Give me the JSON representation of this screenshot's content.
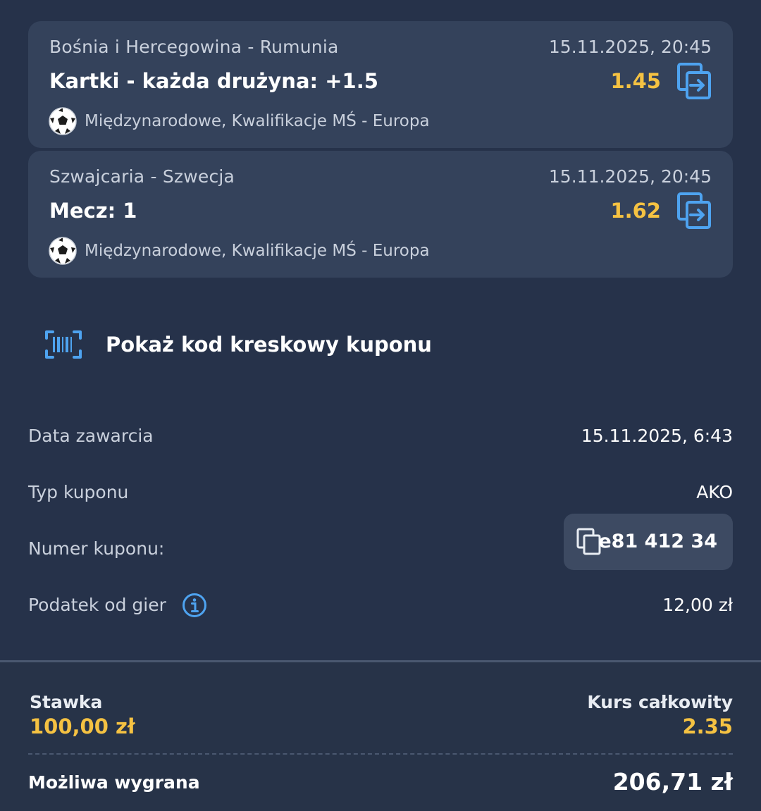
{
  "bets": [
    {
      "match": "Bośnia i Hercegowina - Rumunia",
      "date": "15.11.2025, 20:45",
      "market": "Kartki - każda drużyna: +1.5",
      "odds": "1.45",
      "league": "Międzynarodowe, Kwalifikacje MŚ - Europa",
      "sport_icon": "soccer-ball-icon",
      "action_icon": "copy-bet-icon"
    },
    {
      "match": "Szwajcaria - Szwecja",
      "date": "15.11.2025, 20:45",
      "market": "Mecz: 1",
      "odds": "1.62",
      "league": "Międzynarodowe, Kwalifikacje MŚ - Europa",
      "sport_icon": "soccer-ball-icon",
      "action_icon": "copy-bet-icon"
    }
  ],
  "barcode": {
    "label": "Pokaż kod kreskowy kuponu",
    "icon": "barcode-icon"
  },
  "details": {
    "date_label": "Data zawarcia",
    "date_value": "15.11.2025, 6:43",
    "type_label": "Typ kuponu",
    "type_value": "AKO",
    "number_label": "Numer kuponu:",
    "number_value": "e81 412 34",
    "tax_label": "Podatek od gier",
    "tax_value": "12,00 zł"
  },
  "summary": {
    "stake_label": "Stawka",
    "stake_value": "100,00 zł",
    "total_odds_label": "Kurs całkowity",
    "total_odds_value": "2.35",
    "win_label": "Możliwa wygrana",
    "win_value": "206,71 zł"
  },
  "colors": {
    "background": "#26324a",
    "card": "#34425b",
    "accent_yellow": "#f5c242",
    "accent_blue": "#4ea3f0"
  }
}
